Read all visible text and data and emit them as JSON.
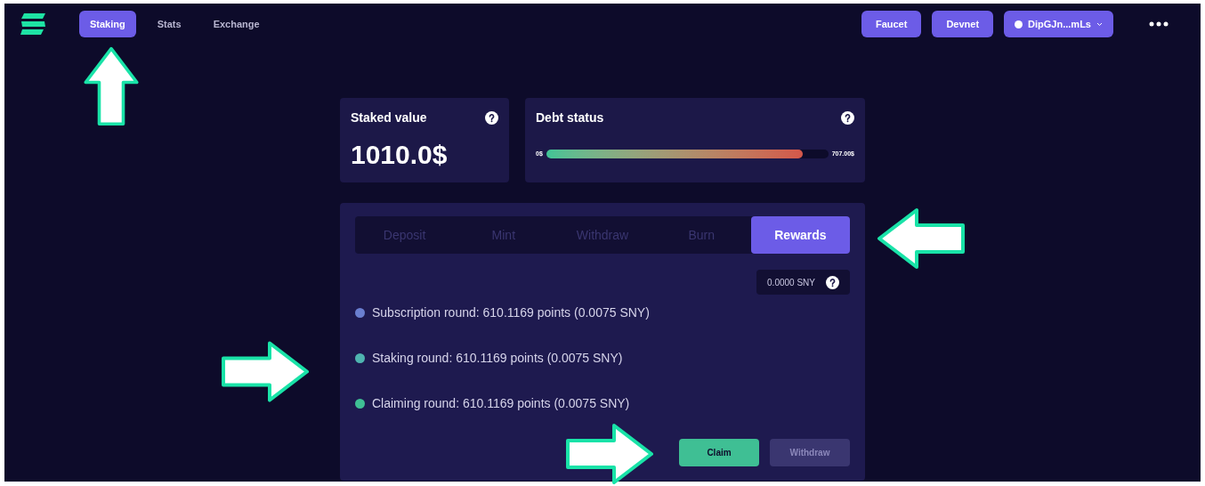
{
  "nav": {
    "items": [
      {
        "label": "Staking",
        "selected": true
      },
      {
        "label": "Stats",
        "selected": false
      },
      {
        "label": "Exchange",
        "selected": false
      }
    ],
    "buttons": [
      "Faucet",
      "Devnet"
    ],
    "wallet": "DipGJn...mLs"
  },
  "staked": {
    "title": "Staked value",
    "value": "1010.0$"
  },
  "debt": {
    "title": "Debt status",
    "min": "0$",
    "max": "707.00$",
    "level": 0.91
  },
  "tabs": [
    {
      "label": "Deposit",
      "selected": false
    },
    {
      "label": "Mint",
      "selected": false
    },
    {
      "label": "Withdraw",
      "selected": false
    },
    {
      "label": "Burn",
      "selected": false
    },
    {
      "label": "Rewards",
      "selected": true
    }
  ],
  "balance": "0.0000 SNY",
  "rounds": [
    {
      "text": "Subscription round: 610.1169 points (0.0075 SNY)",
      "color": "#6a7fd0"
    },
    {
      "text": "Staking round: 610.1169 points (0.0075 SNY)",
      "color": "#4fb4b0"
    },
    {
      "text": "Claiming round: 610.1169 points (0.0075 SNY)",
      "color": "#3fbf94"
    }
  ],
  "actions": [
    {
      "label": "Claim",
      "disabled": false
    },
    {
      "label": "Withdraw",
      "disabled": true
    }
  ]
}
